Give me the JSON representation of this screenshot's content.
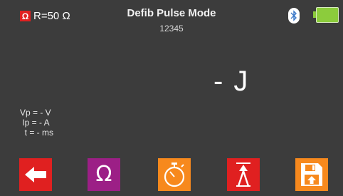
{
  "header": {
    "resistance_icon": "Ω",
    "resistance_label": "R=50 Ω",
    "title": "Defib Pulse Mode",
    "serial": "12345",
    "bluetooth_icon": "bluetooth-icon",
    "battery_icon": "battery-icon"
  },
  "main": {
    "energy": "- J",
    "readouts": {
      "vp": "Vp = - V",
      "ip": " Ip = - A",
      "t": "  t = - ms"
    }
  },
  "toolbar": {
    "buttons": [
      {
        "icon": "back-arrow-icon",
        "color": "#e02020"
      },
      {
        "icon": "ohm-icon",
        "label": "Ω",
        "color": "#9c1f86"
      },
      {
        "icon": "stopwatch-icon",
        "color": "#f7891d"
      },
      {
        "icon": "pulse-icon",
        "color": "#e02020"
      },
      {
        "icon": "save-icon",
        "color": "#f7891d"
      }
    ]
  },
  "colors": {
    "background": "#3c3c3c",
    "red": "#e02020",
    "purple": "#9c1f86",
    "orange": "#f7891d",
    "battery_green": "#8ccc3c"
  }
}
